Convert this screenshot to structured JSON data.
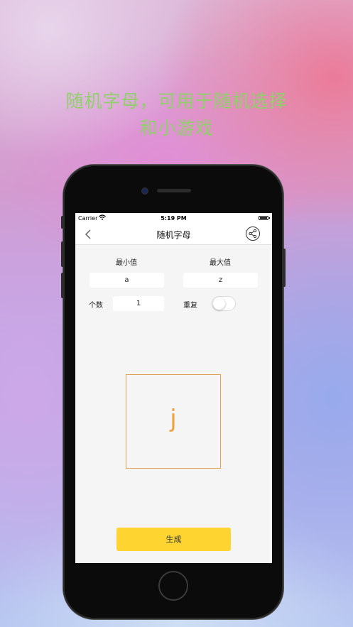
{
  "headline": {
    "line1": "随机字母，可用于随机选择",
    "line2": "和小游戏"
  },
  "status_bar": {
    "carrier": "Carrier",
    "time": "5:19 PM"
  },
  "nav": {
    "title": "随机字母"
  },
  "form": {
    "min_label": "最小值",
    "max_label": "最大值",
    "min_value": "a",
    "max_value": "z",
    "count_label": "个数",
    "count_value": "1",
    "repeat_label": "重复",
    "repeat_on": false
  },
  "result": {
    "letter": "j"
  },
  "generate_label": "生成",
  "colors": {
    "headline": "#8fd06a",
    "accent_yellow": "#fdd430",
    "result_orange": "#f0a040"
  }
}
